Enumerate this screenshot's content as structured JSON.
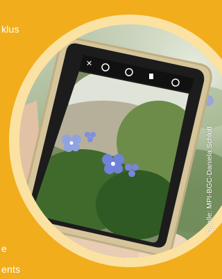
{
  "text_fragments": {
    "top": "klus",
    "middle": "e",
    "bottom": "ents"
  },
  "credit": "Quelle: MPI-BGC-Daniela Schlott",
  "colors": {
    "background": "#f2ad1c",
    "ring": "#fbe2a2",
    "text": "#ffffff"
  },
  "camera_icons": [
    "flash-off-icon",
    "settings-icon",
    "mode-icon",
    "timer-icon",
    "camera-switch-icon"
  ]
}
